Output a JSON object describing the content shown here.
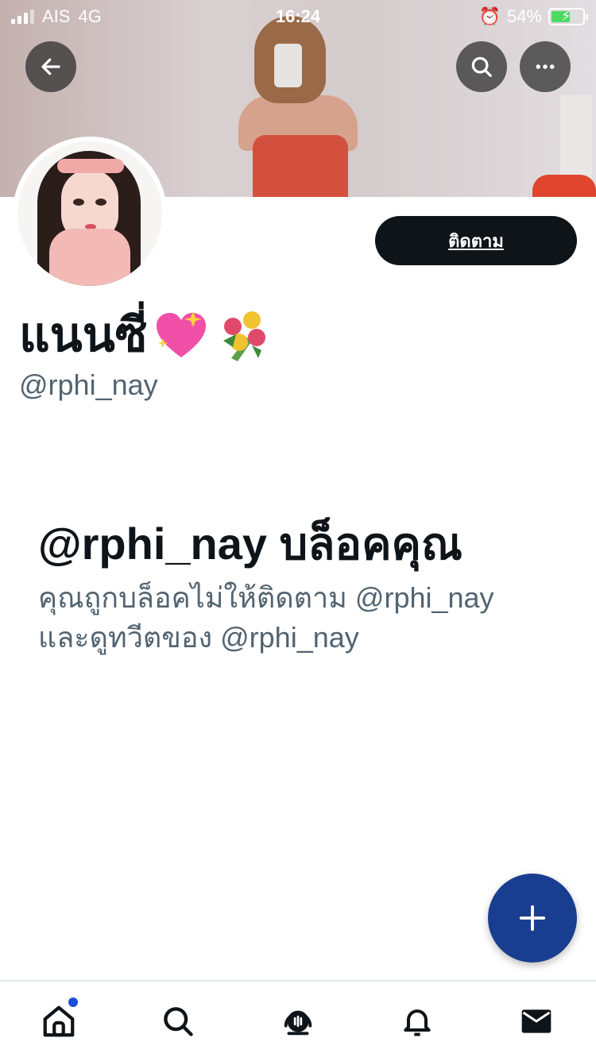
{
  "status_bar": {
    "carrier": "AIS",
    "network": "4G",
    "time": "16:24",
    "battery": "54%",
    "battery_level": 0.54
  },
  "header": {
    "back_icon": "arrow-left-icon",
    "search_icon": "search-icon",
    "more_icon": "more-horizontal-icon"
  },
  "profile": {
    "display_name": "แนนซี่",
    "handle": "@rphi_nay",
    "follow_label": "ติดตาม"
  },
  "blocked": {
    "title": "@rphi_nay บล็อคคุณ",
    "description_line1": "คุณถูกบล็อคไม่ให้ติดตาม @rphi_nay",
    "description_line2": "และดูทวีตของ @rphi_nay"
  },
  "fab": {
    "icon": "plus-icon",
    "color": "#1a3e8f"
  },
  "bottom_nav": {
    "items": [
      {
        "icon": "home-icon",
        "has_badge": true
      },
      {
        "icon": "search-icon"
      },
      {
        "icon": "spaces-icon"
      },
      {
        "icon": "bell-icon"
      },
      {
        "icon": "mail-icon"
      }
    ],
    "badge_color": "#1d4ed8"
  }
}
